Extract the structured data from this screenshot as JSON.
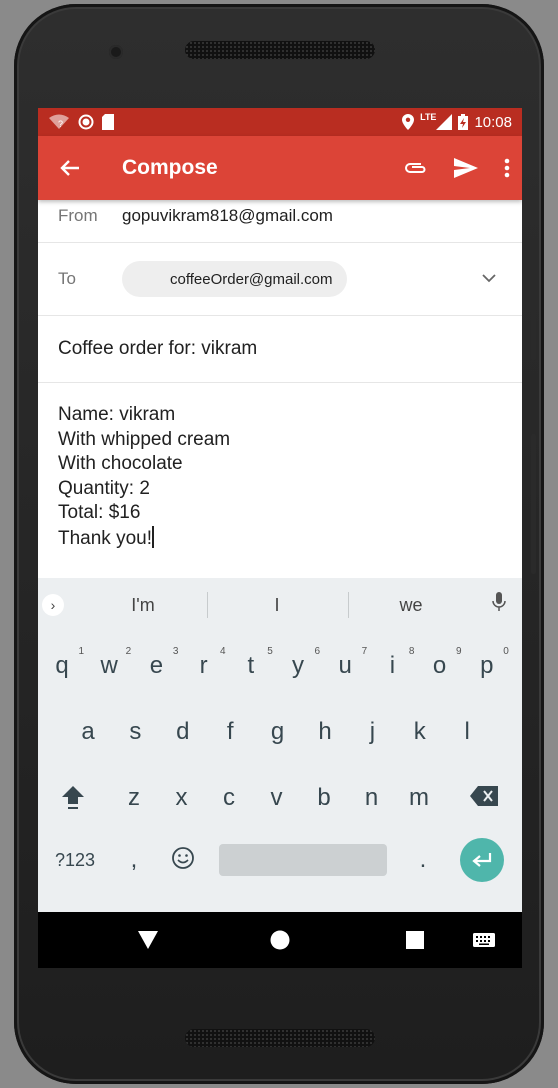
{
  "status_bar": {
    "time": "10:08",
    "network": "LTE",
    "icons": [
      "wifi-question-icon",
      "record-icon",
      "sd-card-icon",
      "location-icon",
      "signal-icon",
      "battery-charging-icon"
    ]
  },
  "app_bar": {
    "title": "Compose",
    "back_icon": "arrow-back-icon",
    "actions": [
      "attach-icon",
      "send-icon",
      "overflow-menu-icon"
    ]
  },
  "from": {
    "label": "From",
    "value": "gopuvikram818@gmail.com"
  },
  "to": {
    "label": "To",
    "recipient": "coffeeOrder@gmail.com"
  },
  "subject": "Coffee order for: vikram",
  "body_lines": [
    "Name: vikram",
    "With whipped cream",
    "With chocolate",
    "Quantity: 2",
    "Total: $16",
    "Thank you!"
  ],
  "keyboard": {
    "suggestions": [
      "I'm",
      "I",
      "we"
    ],
    "row1": [
      "q",
      "w",
      "e",
      "r",
      "t",
      "y",
      "u",
      "i",
      "o",
      "p"
    ],
    "row1_hints": [
      "1",
      "2",
      "3",
      "4",
      "5",
      "6",
      "7",
      "8",
      "9",
      "0"
    ],
    "row2": [
      "a",
      "s",
      "d",
      "f",
      "g",
      "h",
      "j",
      "k",
      "l"
    ],
    "row3": [
      "z",
      "x",
      "c",
      "v",
      "b",
      "n",
      "m"
    ],
    "symbols_key": "?123",
    "comma_key": ",",
    "period_key": "."
  }
}
